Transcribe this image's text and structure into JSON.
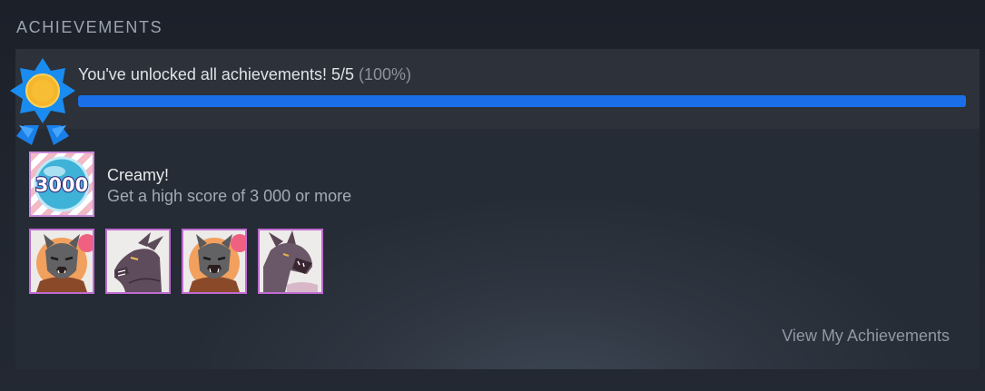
{
  "section": {
    "title": "ACHIEVEMENTS"
  },
  "summary": {
    "text": "You've unlocked all achievements! 5/5",
    "percent_label": "(100%)",
    "progress_fraction": 1.0
  },
  "featured": {
    "icon_label": "3000",
    "name": "Creamy!",
    "description": "Get a high score of 3 000 or more"
  },
  "thumbnails": [
    {
      "icon": "gray-wolf-portrait-icon"
    },
    {
      "icon": "purple-wolf-profile-icon"
    },
    {
      "icon": "gray-wolf-portrait-icon"
    },
    {
      "icon": "purple-wolf-howl-icon"
    }
  ],
  "footer": {
    "link_label": "View My Achievements"
  },
  "colors": {
    "accent": "#1a6fe8",
    "medal_blue": "#1a8cf0",
    "medal_gold": "#f6b62b",
    "frame": "#c06bd2"
  }
}
